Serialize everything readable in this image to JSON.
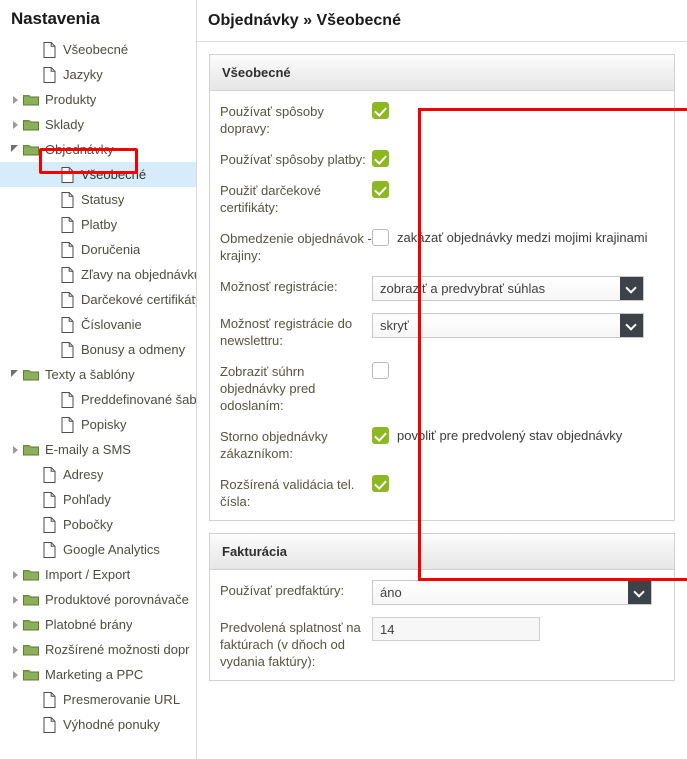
{
  "sidebar": {
    "title": "Nastavenia",
    "items": [
      {
        "label": "Všeobecné",
        "icon": "file-icon",
        "level": 2,
        "twisty": "none",
        "selected": false
      },
      {
        "label": "Jazyky",
        "icon": "file-icon",
        "level": 2,
        "twisty": "none",
        "selected": false
      },
      {
        "label": "Produkty",
        "icon": "folder-icon",
        "level": 1,
        "twisty": "collapsed",
        "selected": false
      },
      {
        "label": "Sklady",
        "icon": "folder-icon",
        "level": 1,
        "twisty": "collapsed",
        "selected": false
      },
      {
        "label": "Objednávky",
        "icon": "folder-icon",
        "level": 1,
        "twisty": "expanded",
        "selected": false
      },
      {
        "label": "Všeobecné",
        "icon": "file-icon",
        "level": 3,
        "twisty": "none",
        "selected": true
      },
      {
        "label": "Statusy",
        "icon": "file-icon",
        "level": 3,
        "twisty": "none",
        "selected": false
      },
      {
        "label": "Platby",
        "icon": "file-icon",
        "level": 3,
        "twisty": "none",
        "selected": false
      },
      {
        "label": "Doručenia",
        "icon": "file-icon",
        "level": 3,
        "twisty": "none",
        "selected": false
      },
      {
        "label": "Zľavy na objednávku",
        "icon": "file-icon",
        "level": 3,
        "twisty": "none",
        "selected": false
      },
      {
        "label": "Darčekové certifikáty",
        "icon": "file-icon",
        "level": 3,
        "twisty": "none",
        "selected": false
      },
      {
        "label": "Číslovanie",
        "icon": "file-icon",
        "level": 3,
        "twisty": "none",
        "selected": false
      },
      {
        "label": "Bonusy a odmeny",
        "icon": "file-icon",
        "level": 3,
        "twisty": "none",
        "selected": false
      },
      {
        "label": "Texty a šablóny",
        "icon": "folder-icon",
        "level": 1,
        "twisty": "expanded",
        "selected": false
      },
      {
        "label": "Preddefinované šabló",
        "icon": "file-icon",
        "level": 3,
        "twisty": "none",
        "selected": false
      },
      {
        "label": "Popisky",
        "icon": "file-icon",
        "level": 3,
        "twisty": "none",
        "selected": false
      },
      {
        "label": "E-maily a SMS",
        "icon": "folder-icon",
        "level": 1,
        "twisty": "collapsed",
        "selected": false
      },
      {
        "label": "Adresy",
        "icon": "file-icon",
        "level": 2,
        "twisty": "none",
        "selected": false
      },
      {
        "label": "Pohľady",
        "icon": "file-icon",
        "level": 2,
        "twisty": "none",
        "selected": false
      },
      {
        "label": "Pobočky",
        "icon": "file-icon",
        "level": 2,
        "twisty": "none",
        "selected": false
      },
      {
        "label": "Google Analytics",
        "icon": "file-icon",
        "level": 2,
        "twisty": "none",
        "selected": false
      },
      {
        "label": "Import / Export",
        "icon": "folder-icon",
        "level": 1,
        "twisty": "collapsed",
        "selected": false
      },
      {
        "label": "Produktové porovnávače",
        "icon": "folder-icon",
        "level": 1,
        "twisty": "collapsed",
        "selected": false
      },
      {
        "label": "Platobné brány",
        "icon": "folder-icon",
        "level": 1,
        "twisty": "collapsed",
        "selected": false
      },
      {
        "label": "Rozšírené možnosti dopr",
        "icon": "folder-icon",
        "level": 1,
        "twisty": "collapsed",
        "selected": false
      },
      {
        "label": "Marketing a PPC",
        "icon": "folder-icon",
        "level": 1,
        "twisty": "collapsed",
        "selected": false
      },
      {
        "label": "Presmerovanie URL",
        "icon": "file-icon",
        "level": 2,
        "twisty": "none",
        "selected": false
      },
      {
        "label": "Výhodné ponuky",
        "icon": "file-icon",
        "level": 2,
        "twisty": "none",
        "selected": false
      }
    ]
  },
  "header": {
    "title": "Objednávky » Všeobecné"
  },
  "panels": {
    "general": {
      "heading": "Všeobecné",
      "rows": [
        {
          "label": "Používať spôsoby dopravy:",
          "type": "checkbox",
          "checked": true,
          "text": ""
        },
        {
          "label": "Používať spôsoby platby:",
          "type": "checkbox",
          "checked": true,
          "text": ""
        },
        {
          "label": "Použiť darčekové certifikáty:",
          "type": "checkbox",
          "checked": true,
          "text": ""
        },
        {
          "label": "Obmedzenie objednávok - krajiny:",
          "type": "checkbox",
          "checked": false,
          "text": "zakázať objednávky medzi mojimi krajinami"
        },
        {
          "label": "Možnosť registrácie:",
          "type": "select",
          "value": "zobraziť a predvybrať súhlas"
        },
        {
          "label": "Možnosť registrácie do newslettru:",
          "type": "select",
          "value": "skryť"
        },
        {
          "label": "Zobraziť súhrn objednávky pred odoslaním:",
          "type": "checkbox",
          "checked": false,
          "text": ""
        },
        {
          "label": "Storno objednávky zákazníkom:",
          "type": "checkbox",
          "checked": true,
          "text": "povoliť pre predvolený stav objednávky"
        },
        {
          "label": "Rozšírená validácia tel. čísla:",
          "type": "checkbox",
          "checked": true,
          "text": ""
        }
      ]
    },
    "invoicing": {
      "heading": "Fakturácia",
      "rows": [
        {
          "label": "Používať predfaktúry:",
          "type": "select",
          "value": "áno"
        },
        {
          "label": "Predvolená splatnosť na faktúrach (v dňoch od vydania faktúry):",
          "type": "text",
          "value": "14"
        }
      ]
    }
  },
  "annotations": {
    "sidebar_highlight_color": "#f50000",
    "form_highlight_color": "#f50000"
  },
  "colors": {
    "checkbox_on": "#8cb821",
    "select_button": "#3c4348",
    "selection_row": "#d6ecfa",
    "folder": "#8cb05a"
  }
}
